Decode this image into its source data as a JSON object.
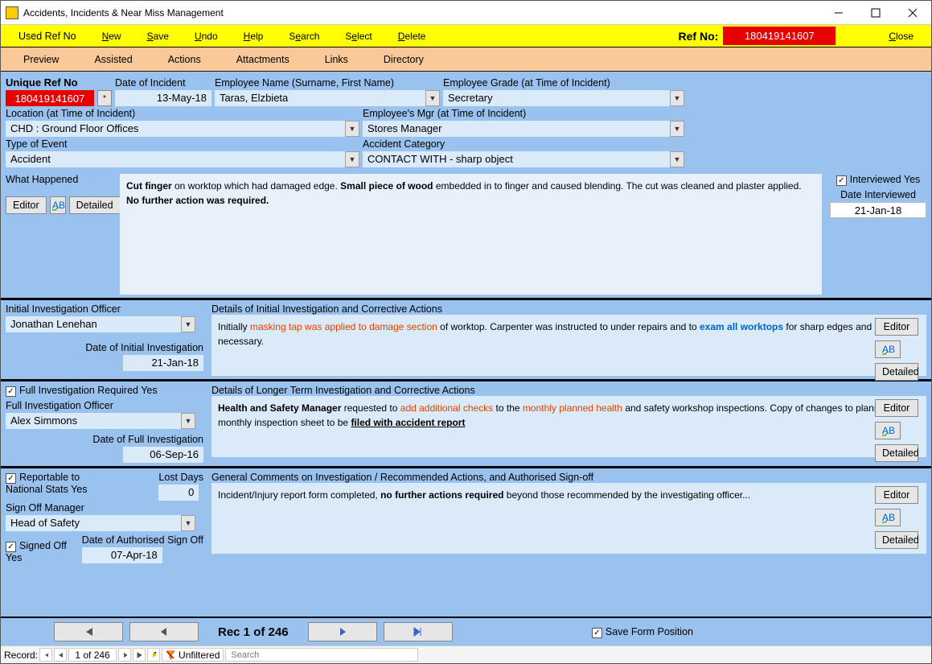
{
  "window": {
    "title": "Accidents, Incidents & Near Miss Management"
  },
  "menu": {
    "used_ref": "Used Ref No",
    "new": [
      "N",
      "ew"
    ],
    "save": [
      "S",
      "ave"
    ],
    "undo": [
      "U",
      "ndo"
    ],
    "help": [
      "H",
      "elp"
    ],
    "search": [
      "S",
      "e",
      "arch"
    ],
    "select": [
      "S",
      "e",
      "lect"
    ],
    "delete": [
      "D",
      "elete"
    ],
    "close": [
      "C",
      "lose"
    ],
    "ref_label": "Ref No:",
    "ref_value": "180419141607"
  },
  "submenu": {
    "preview": "Preview",
    "assisted": "Assisted",
    "actions": "Actions",
    "attachments": "Attactments",
    "links": "Links",
    "directory": "Directory"
  },
  "header": {
    "uniq_label": "Unique Ref No",
    "uniq_value": "180419141607",
    "uniq_btn": "*",
    "doi_label": "Date of Incident",
    "doi_value": "13-May-18",
    "emp_label": "Employee Name (Surname, First Name)",
    "emp_value": "Taras, Elzbieta",
    "grade_label": "Employee Grade (at Time of Incident)",
    "grade_value": "Secretary",
    "loc_label": "Location (at Time of Incident)",
    "loc_value": "CHD : Ground Floor Offices",
    "mgr_label": "Employee's Mgr (at Time of Incident)",
    "mgr_value": "Stores Manager",
    "type_label": "Type of Event",
    "type_value": "Accident",
    "cat_label": "Accident Category",
    "cat_value": "CONTACT WITH - sharp object"
  },
  "what": {
    "label": "What Happened",
    "frag_cut": "Cut finger",
    "frag1": " on  worktop which had damaged edge.  ",
    "frag_wood": "Small piece of wood",
    "frag2": " embedded in to finger and caused blending.  The cut was cleaned and plaster applied.  ",
    "frag_nfa": "No further action was required.",
    "editor": "Editor",
    "detailed": "Detailed",
    "interviewed_label": "Interviewed Yes",
    "interviewed_date_label": "Date Interviewed",
    "interviewed_date": "21-Jan-18"
  },
  "initial": {
    "officer_label": "Initial Investigation Officer",
    "officer": "Jonathan Lenehan",
    "date_label": "Date of Initial Investigation",
    "date": "21-Jan-18",
    "details_label": "Details of Initial Investigation and Corrective Actions",
    "p_lead": "Initially ",
    "p_red": "masking tap was applied to damage section",
    "p_mid": " of worktop.  Carpenter was instructed to under repairs and to ",
    "p_blue": "exam all worktops",
    "p_tail": " for sharp edges and repair as necessary.",
    "editor": "Editor",
    "detailed": "Detailed"
  },
  "full": {
    "req_label": "Full Investigation Required Yes",
    "officer_label": "Full Investigation Officer",
    "officer": "Alex Simmons",
    "date_label": "Date of Full Investigation",
    "date": "06-Sep-16",
    "details_label": "Details of Longer Term Investigation and Corrective Actions",
    "p1_bold": "Health and Safety Manager",
    "p1a": " requested to ",
    "p1_red1": "add additional checks",
    "p1b": " to the ",
    "p1_red2": "monthly planned health",
    "p1c": " and safety workshop inspections.  Copy of changes to planned monthly inspection sheet to be ",
    "p1_u": "filed with accident report",
    "editor": "Editor",
    "detailed": "Detailed"
  },
  "signoff": {
    "report_label": "Reportable to National Stats Yes",
    "lost_label": "Lost Days",
    "lost_value": "0",
    "mgr_label": "Sign Off Manager",
    "mgr": "Head of Safety",
    "signed_label": "Signed Off Yes",
    "auth_label": "Date of Authorised Sign Off",
    "auth_date": "07-Apr-18",
    "gc_label": "General Comments on Investigation / Recommended Actions, and Authorised Sign-off",
    "gc1": "Incident/Injury report form completed, ",
    "gc_bold": "no further actions required",
    "gc2": " beyond those recommended by the investigating officer...",
    "editor": "Editor",
    "detailed": "Detailed"
  },
  "footer": {
    "rec": "Rec 1 of 246",
    "save_pos": "Save Form Position"
  },
  "status": {
    "record": "Record:",
    "pos": "1 of 246",
    "unfiltered": "Unfiltered",
    "search_ph": "Search"
  }
}
